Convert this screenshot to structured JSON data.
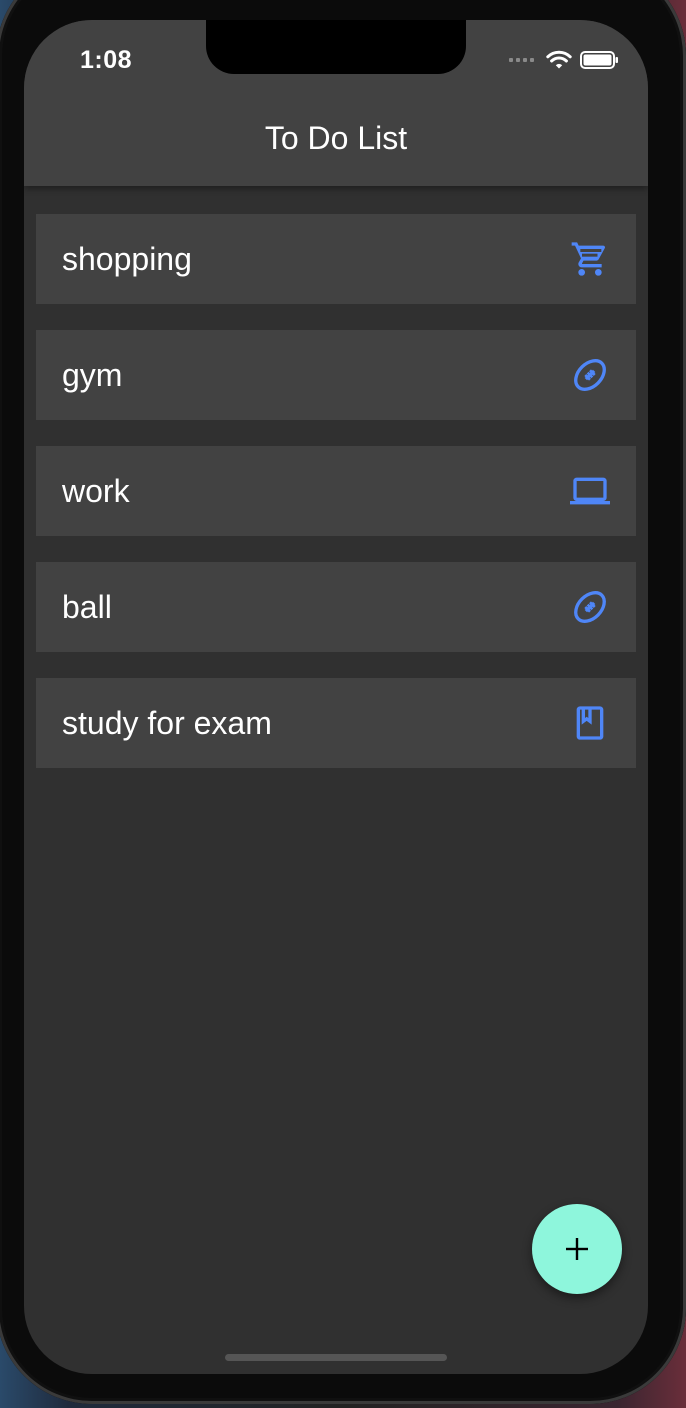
{
  "status_bar": {
    "time": "1:08"
  },
  "app_bar": {
    "title": "To Do List"
  },
  "colors": {
    "background": "#303030",
    "surface": "#424242",
    "accent_icon": "#4f86f7",
    "fab": "#8ef6dc"
  },
  "todos": [
    {
      "label": "shopping",
      "icon": "shopping-cart-icon"
    },
    {
      "label": "gym",
      "icon": "football-icon"
    },
    {
      "label": "work",
      "icon": "laptop-icon"
    },
    {
      "label": "ball",
      "icon": "football-icon"
    },
    {
      "label": "study for exam",
      "icon": "book-icon"
    }
  ],
  "fab": {
    "icon": "plus-icon"
  }
}
